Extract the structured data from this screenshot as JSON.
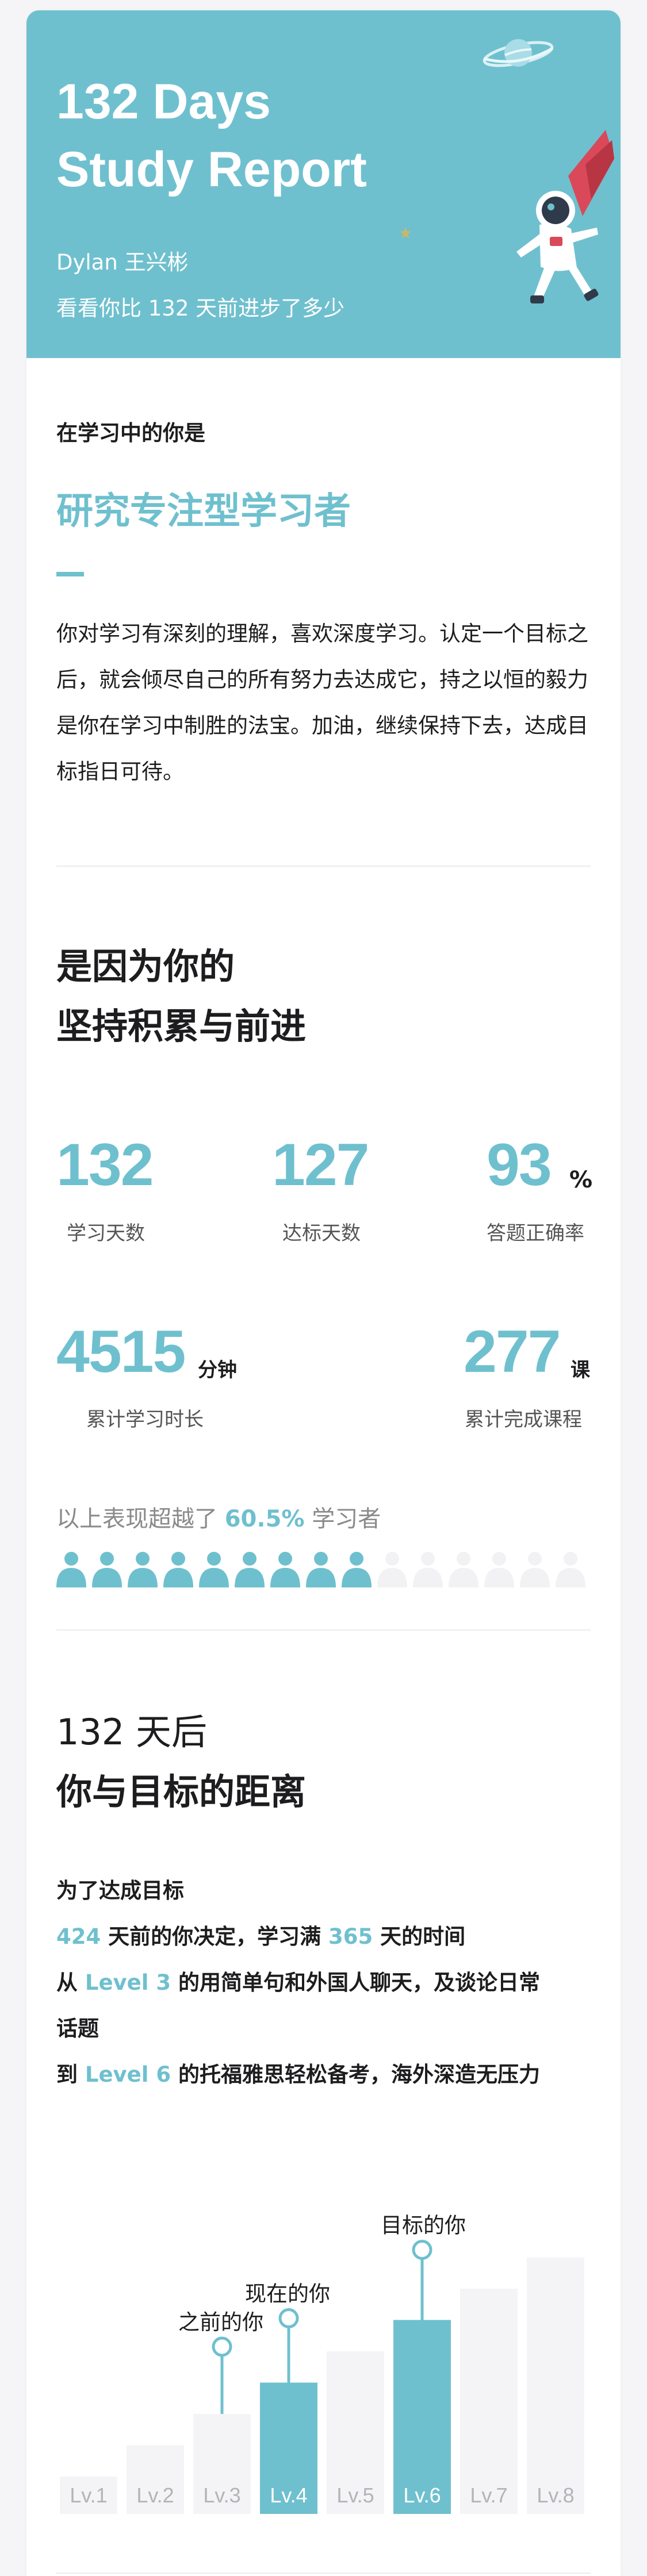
{
  "colors": {
    "accent": "#6fc0ce",
    "bar_inactive": "#f4f4f7",
    "text": "#1d1d1f"
  },
  "hero": {
    "title_line1": "132 Days",
    "title_line2": "Study Report",
    "user": "Dylan 王兴彬",
    "subtitle": "看看你比 132 天前进步了多少",
    "icons": [
      "planet-icon",
      "star-icon",
      "astronaut-illustration"
    ]
  },
  "profile": {
    "label": "在学习中的你是",
    "type": "研究专注型学习者",
    "description": "你对学习有深刻的理解，喜欢深度学习。认定一个目标之后，就会倾尽自己的所有努力去达成它，持之以恒的毅力是你在学习中制胜的法宝。加油，继续保持下去，达成目标指日可待。"
  },
  "stats_section": {
    "heading_line1": "是因为你的",
    "heading_line2": "坚持积累与前进",
    "study_days": {
      "value": "132",
      "label": "学习天数"
    },
    "target_days": {
      "value": "127",
      "label": "达标天数"
    },
    "accuracy": {
      "value": "93",
      "unit": "%",
      "label": "答题正确率"
    },
    "study_time": {
      "value": "4515",
      "unit": "分钟",
      "label": "累计学习时长"
    },
    "courses": {
      "value": "277",
      "unit": "课",
      "label": "累计完成课程"
    },
    "exceed_prefix": "以上表现超越了",
    "exceed_value": "60.5%",
    "exceed_suffix": "学习者",
    "people_total": 15,
    "people_filled": 9
  },
  "goal_section": {
    "heading_line1": "132 天后",
    "heading_line2": "你与目标的距离",
    "line1": "为了达成目标",
    "line2_days": "424",
    "line2_a": "天前的你决定，学习满",
    "line2_days2": "365",
    "line2_b": "天的时间",
    "line3_prefix": "从",
    "line3_level": "Level 3",
    "line3_text": "的用简单句和外国人聊天，及谈论日常",
    "line4": "话题",
    "line5_prefix": "到",
    "line5_level": "Level 6",
    "line5_text": "的托福雅思轻松备考，海外深造无压力"
  },
  "chart_data": {
    "type": "bar",
    "categories": [
      "Lv.1",
      "Lv.2",
      "Lv.3",
      "Lv.4",
      "Lv.5",
      "Lv.6",
      "Lv.7",
      "Lv.8"
    ],
    "values": [
      1,
      2,
      3,
      4,
      5,
      6,
      7,
      8
    ],
    "highlighted": [
      "Lv.4",
      "Lv.6"
    ],
    "markers": [
      {
        "label": "之前的你",
        "level": "Lv.3"
      },
      {
        "label": "现在的你",
        "level": "Lv.4"
      },
      {
        "label": "目标的你",
        "level": "Lv.6"
      }
    ]
  }
}
